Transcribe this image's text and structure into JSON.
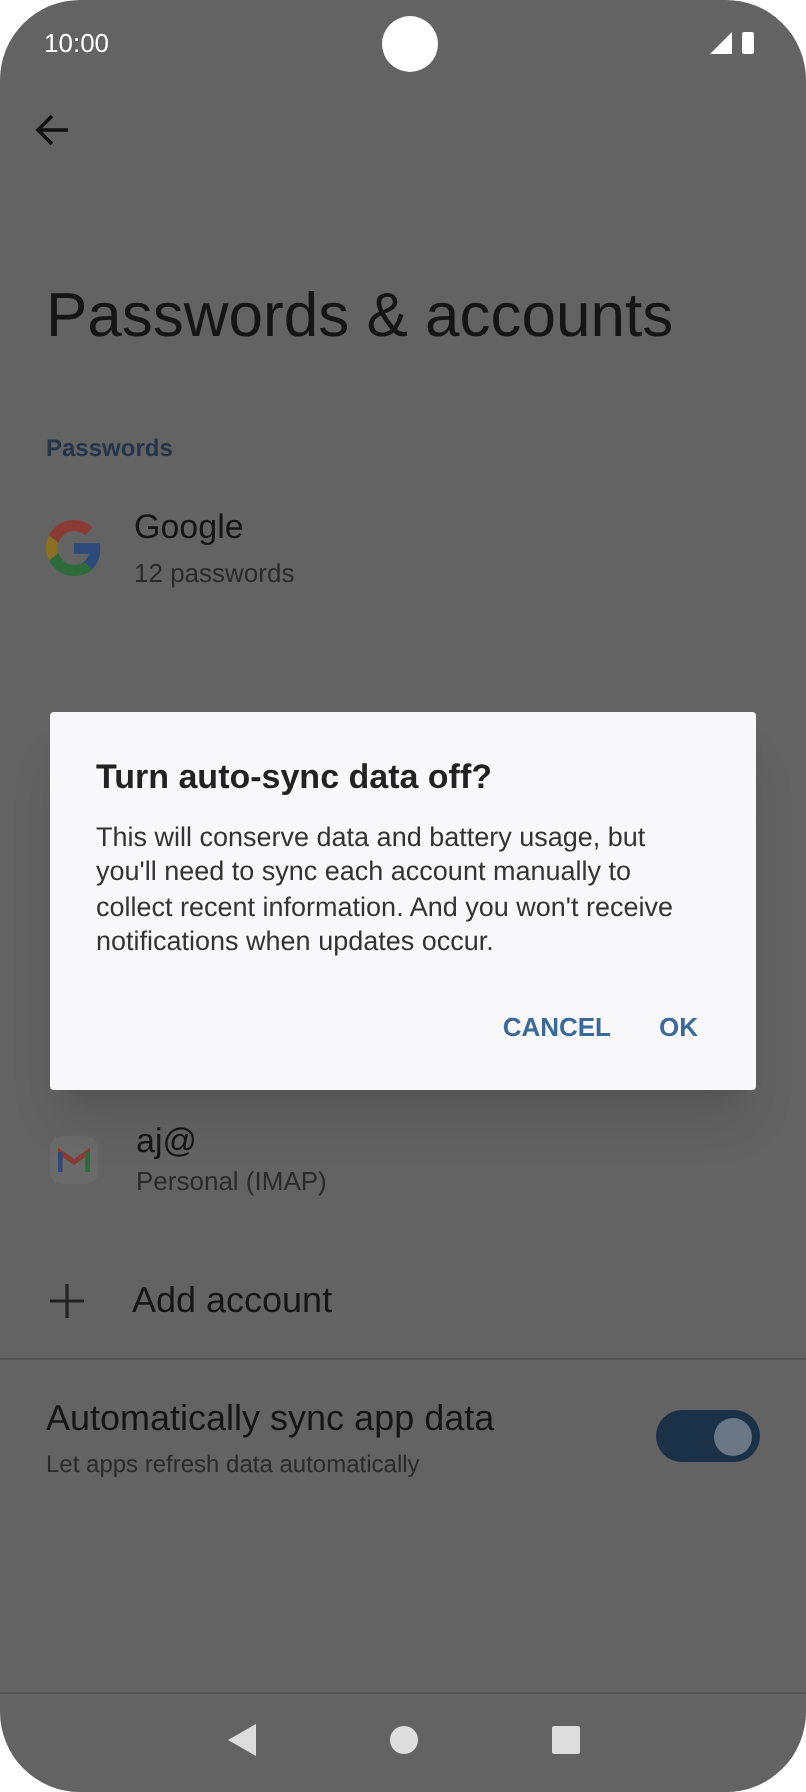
{
  "status_bar": {
    "time": "10:00"
  },
  "title": "Passwords & accounts",
  "section": "Passwords",
  "password_items": [
    {
      "title": "Google",
      "subtitle": "12 passwords"
    }
  ],
  "accounts": [
    {
      "title": "aj@",
      "subtitle": "Personal (IMAP)"
    }
  ],
  "add_account": "Add account",
  "auto_sync": {
    "title": "Automatically sync app data",
    "subtitle": "Let apps refresh data automatically",
    "on": true
  },
  "dialog": {
    "title": "Turn auto-sync data off?",
    "message": "This will conserve data and battery usage, but you'll need to sync each account manually to collect recent information. And you won't receive notifications when updates occur.",
    "buttons": [
      "CANCEL",
      "OK"
    ]
  }
}
